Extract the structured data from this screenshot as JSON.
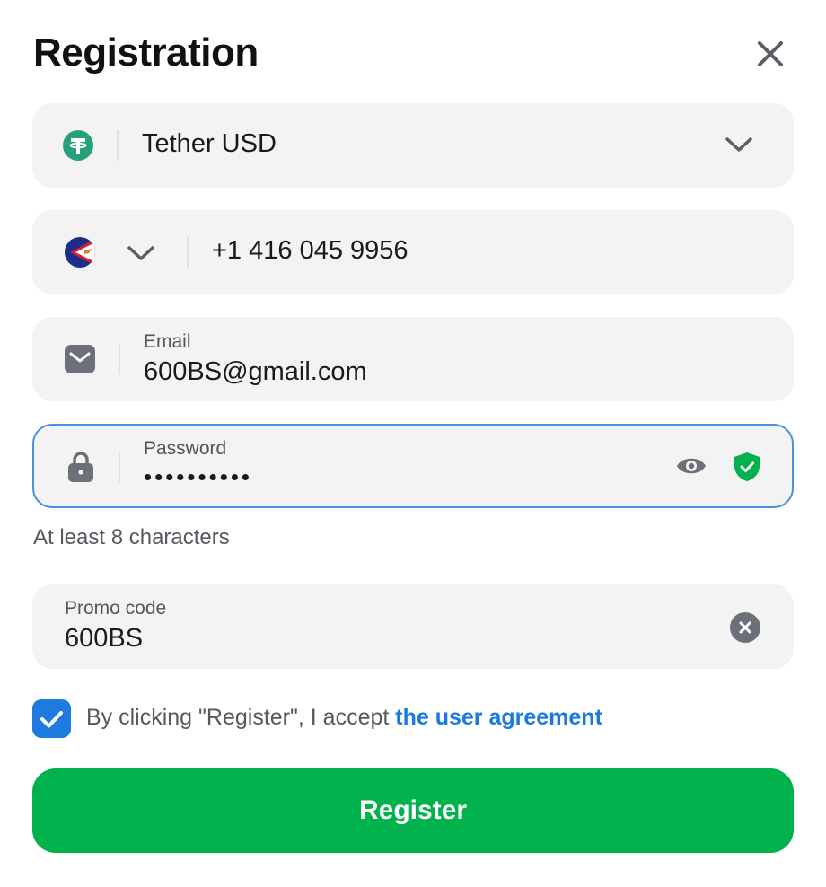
{
  "header": {
    "title": "Registration"
  },
  "currency": {
    "value": "Tether USD",
    "icon": "tether-icon"
  },
  "phone": {
    "country_flag": "flag-icon",
    "value": "+1 416 045 9956"
  },
  "email": {
    "label": "Email",
    "value": "600BS@gmail.com"
  },
  "password": {
    "label": "Password",
    "value": "••••••••••",
    "hint": "At least 8 characters"
  },
  "promo": {
    "label": "Promo code",
    "value": "600BS"
  },
  "agreement": {
    "text": "By clicking \"Register\", I accept ",
    "link": "the user agreement",
    "checked": true
  },
  "actions": {
    "register_label": "Register"
  },
  "colors": {
    "accent_blue": "#1a7ae0",
    "register_green": "#00b14c",
    "tether_teal": "#26a17b",
    "shield_green": "#00b14c",
    "field_bg": "#f3f3f4"
  }
}
